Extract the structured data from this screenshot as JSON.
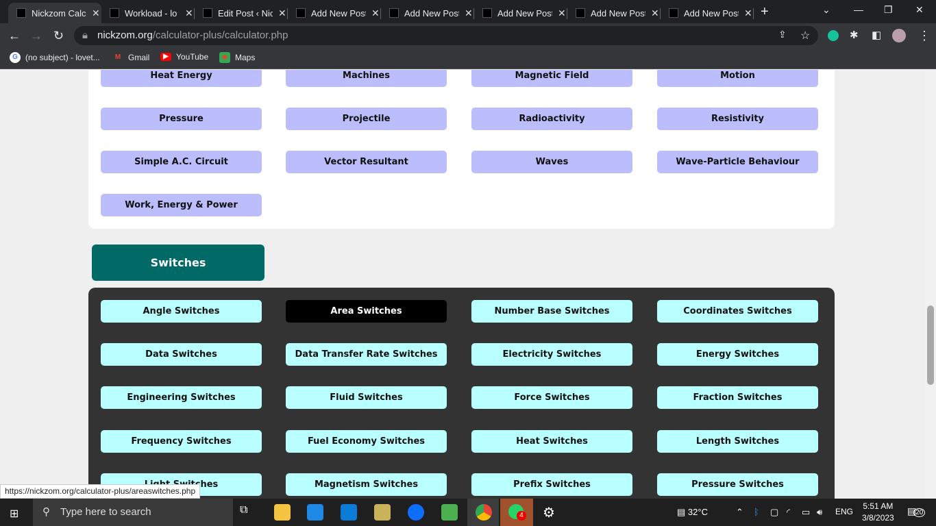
{
  "browser": {
    "tabs": [
      {
        "title": "Nickzom Calculator",
        "active": true
      },
      {
        "title": "Workload - lo"
      },
      {
        "title": "Edit Post ‹ Nickzom"
      },
      {
        "title": "Add New Post"
      },
      {
        "title": "Add New Post"
      },
      {
        "title": "Add New Post"
      },
      {
        "title": "Add New Post"
      },
      {
        "title": "Add New Post"
      }
    ],
    "url_host": "nickzom.org",
    "url_path": "/calculator-plus/calculator.php",
    "bookmarks": [
      {
        "label": "(no subject) - lovet...",
        "icon": "google-icon"
      },
      {
        "label": "Gmail",
        "icon": "gmail-icon"
      },
      {
        "label": "YouTube",
        "icon": "youtube-icon"
      },
      {
        "label": "Maps",
        "icon": "maps-icon"
      }
    ]
  },
  "physics": {
    "items": [
      "Heat Energy",
      "Machines",
      "Magnetic Field",
      "Motion",
      "Pressure",
      "Projectile",
      "Radioactivity",
      "Resistivity",
      "Simple A.C. Circuit",
      "Vector Resultant",
      "Waves",
      "Wave-Particle Behaviour",
      "Work, Energy & Power"
    ]
  },
  "switches": {
    "title": "Switches",
    "active": "Area Switches",
    "items": [
      "Angle Switches",
      "Area Switches",
      "Number Base Switches",
      "Coordinates Switches",
      "Data Switches",
      "Data Transfer Rate Switches",
      "Electricity Switches",
      "Energy Switches",
      "Engineering Switches",
      "Fluid Switches",
      "Force Switches",
      "Fraction Switches",
      "Frequency Switches",
      "Fuel Economy Switches",
      "Heat Switches",
      "Length Switches",
      "Light Switches",
      "Magnetism Switches",
      "Prefix Switches",
      "Pressure Switches"
    ]
  },
  "colors": {
    "physics_button": "#bcbdfc",
    "switch_button": "#baffff",
    "switch_active": "#000000",
    "switches_header": "#016a67",
    "dark_panel": "#333333"
  },
  "status_url": "https://nickzom.org/calculator-plus/areaswitches.php",
  "taskbar": {
    "search_placeholder": "Type here to search",
    "weather": "32°C",
    "language": "ENG",
    "time": "5:51 AM",
    "date": "3/8/2023",
    "whatsapp_badge": "4",
    "notifications": "20"
  }
}
